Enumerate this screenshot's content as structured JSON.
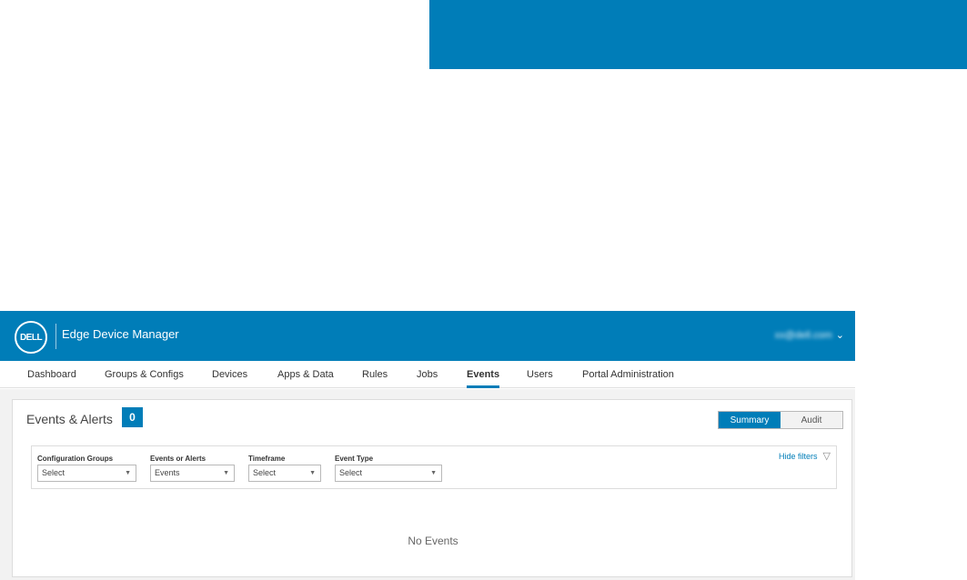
{
  "colors": {
    "brand": "#007db8",
    "background": "#f2f2f2"
  },
  "header": {
    "logo_text": "DELL",
    "app_title": "Edge Device Manager",
    "user_email": "xx@dell.com",
    "user_menu_icon": "chevron-down-icon"
  },
  "nav": {
    "items": [
      "Dashboard",
      "Groups & Configs",
      "Devices",
      "Apps & Data",
      "Rules",
      "Jobs",
      "Events",
      "Users",
      "Portal Administration"
    ],
    "active": "Events"
  },
  "panel": {
    "title": "Events & Alerts",
    "count": "0",
    "toggle": {
      "summary": "Summary",
      "audit": "Audit",
      "selected": "Summary"
    }
  },
  "filters": {
    "hide_label": "Hide filters",
    "icon": "filter-icon",
    "fields": [
      {
        "label": "Configuration Groups",
        "value": "Select"
      },
      {
        "label": "Events or Alerts",
        "value": "Events"
      },
      {
        "label": "Timeframe",
        "value": "Select"
      },
      {
        "label": "Event Type",
        "value": "Select"
      }
    ]
  },
  "empty_state": "No Events"
}
